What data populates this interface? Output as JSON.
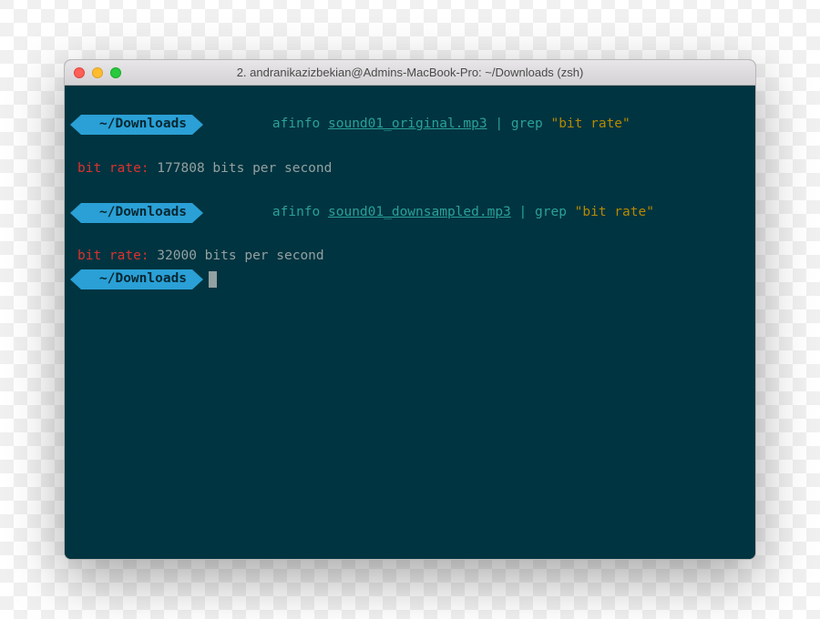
{
  "window": {
    "title": "2. andranikazizbekian@Admins-MacBook-Pro: ~/Downloads (zsh)"
  },
  "prompt": {
    "path": "~/Downloads"
  },
  "history": [
    {
      "cmd": {
        "tool": "afinfo",
        "arg": "sound01_original.mp3",
        "pipe": " | ",
        "grep": "grep",
        "grepArg": "\"bit rate\""
      },
      "output": {
        "label": "bit rate:",
        "value": " 177808 bits per second"
      }
    },
    {
      "cmd": {
        "tool": "afinfo",
        "arg": "sound01_downsampled.mp3",
        "pipe": " | ",
        "grep": "grep",
        "grepArg": "\"bit rate\""
      },
      "output": {
        "label": "bit rate:",
        "value": " 32000 bits per second"
      }
    }
  ]
}
